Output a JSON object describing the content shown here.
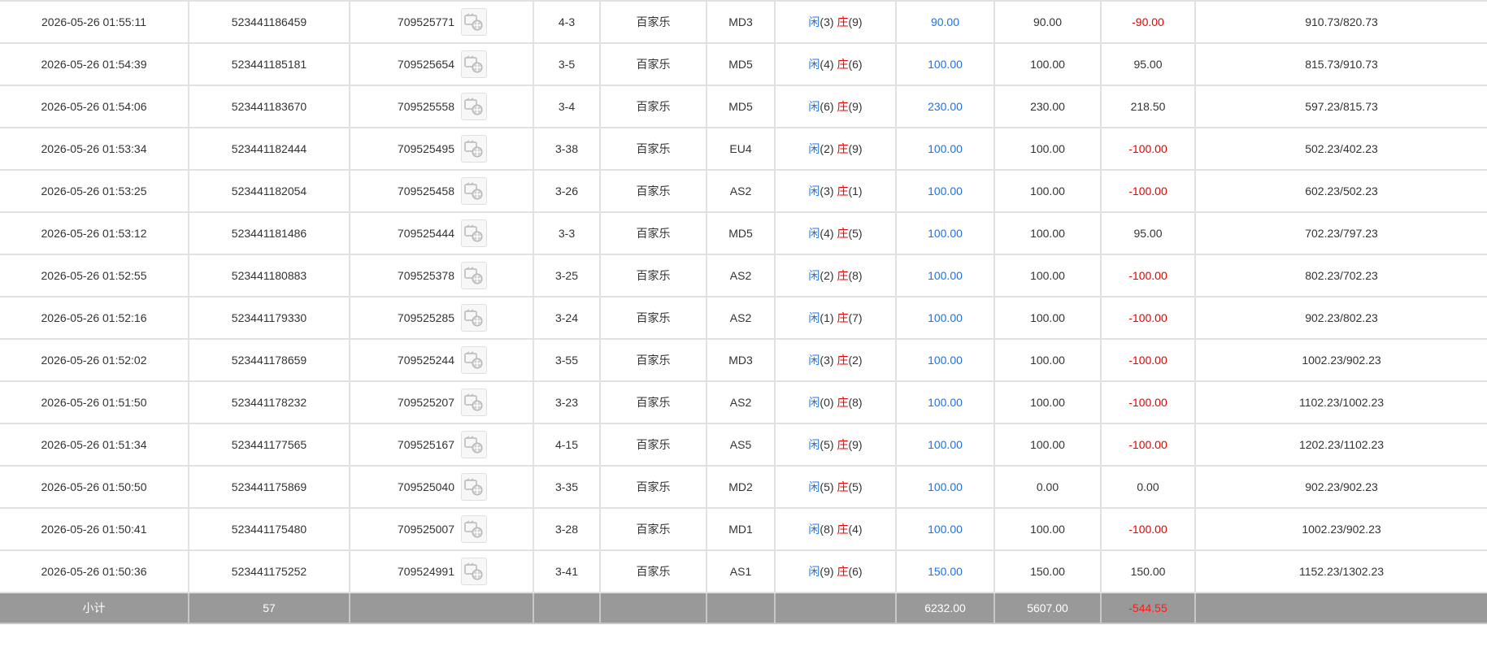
{
  "rows": [
    {
      "time": "2026-05-26 01:55:11",
      "order": "523441186459",
      "game": "709525771",
      "table": "4-3",
      "type": "百家乐",
      "room": "MD3",
      "player": "3",
      "banker": "9",
      "bet": "90.00",
      "valid": "90.00",
      "win": "-90.00",
      "balance": "910.73/820.73",
      "win_negative": true
    },
    {
      "time": "2026-05-26 01:54:39",
      "order": "523441185181",
      "game": "709525654",
      "table": "3-5",
      "type": "百家乐",
      "room": "MD5",
      "player": "4",
      "banker": "6",
      "bet": "100.00",
      "valid": "100.00",
      "win": "95.00",
      "balance": "815.73/910.73",
      "win_negative": false
    },
    {
      "time": "2026-05-26 01:54:06",
      "order": "523441183670",
      "game": "709525558",
      "table": "3-4",
      "type": "百家乐",
      "room": "MD5",
      "player": "6",
      "banker": "9",
      "bet": "230.00",
      "valid": "230.00",
      "win": "218.50",
      "balance": "597.23/815.73",
      "win_negative": false
    },
    {
      "time": "2026-05-26 01:53:34",
      "order": "523441182444",
      "game": "709525495",
      "table": "3-38",
      "type": "百家乐",
      "room": "EU4",
      "player": "2",
      "banker": "9",
      "bet": "100.00",
      "valid": "100.00",
      "win": "-100.00",
      "balance": "502.23/402.23",
      "win_negative": true
    },
    {
      "time": "2026-05-26 01:53:25",
      "order": "523441182054",
      "game": "709525458",
      "table": "3-26",
      "type": "百家乐",
      "room": "AS2",
      "player": "3",
      "banker": "1",
      "bet": "100.00",
      "valid": "100.00",
      "win": "-100.00",
      "balance": "602.23/502.23",
      "win_negative": true
    },
    {
      "time": "2026-05-26 01:53:12",
      "order": "523441181486",
      "game": "709525444",
      "table": "3-3",
      "type": "百家乐",
      "room": "MD5",
      "player": "4",
      "banker": "5",
      "bet": "100.00",
      "valid": "100.00",
      "win": "95.00",
      "balance": "702.23/797.23",
      "win_negative": false
    },
    {
      "time": "2026-05-26 01:52:55",
      "order": "523441180883",
      "game": "709525378",
      "table": "3-25",
      "type": "百家乐",
      "room": "AS2",
      "player": "2",
      "banker": "8",
      "bet": "100.00",
      "valid": "100.00",
      "win": "-100.00",
      "balance": "802.23/702.23",
      "win_negative": true
    },
    {
      "time": "2026-05-26 01:52:16",
      "order": "523441179330",
      "game": "709525285",
      "table": "3-24",
      "type": "百家乐",
      "room": "AS2",
      "player": "1",
      "banker": "7",
      "bet": "100.00",
      "valid": "100.00",
      "win": "-100.00",
      "balance": "902.23/802.23",
      "win_negative": true
    },
    {
      "time": "2026-05-26 01:52:02",
      "order": "523441178659",
      "game": "709525244",
      "table": "3-55",
      "type": "百家乐",
      "room": "MD3",
      "player": "3",
      "banker": "2",
      "bet": "100.00",
      "valid": "100.00",
      "win": "-100.00",
      "balance": "1002.23/902.23",
      "win_negative": true
    },
    {
      "time": "2026-05-26 01:51:50",
      "order": "523441178232",
      "game": "709525207",
      "table": "3-23",
      "type": "百家乐",
      "room": "AS2",
      "player": "0",
      "banker": "8",
      "bet": "100.00",
      "valid": "100.00",
      "win": "-100.00",
      "balance": "1102.23/1002.23",
      "win_negative": true
    },
    {
      "time": "2026-05-26 01:51:34",
      "order": "523441177565",
      "game": "709525167",
      "table": "4-15",
      "type": "百家乐",
      "room": "AS5",
      "player": "5",
      "banker": "9",
      "bet": "100.00",
      "valid": "100.00",
      "win": "-100.00",
      "balance": "1202.23/1102.23",
      "win_negative": true
    },
    {
      "time": "2026-05-26 01:50:50",
      "order": "523441175869",
      "game": "709525040",
      "table": "3-35",
      "type": "百家乐",
      "room": "MD2",
      "player": "5",
      "banker": "5",
      "bet": "100.00",
      "valid": "0.00",
      "win": "0.00",
      "balance": "902.23/902.23",
      "win_negative": false
    },
    {
      "time": "2026-05-26 01:50:41",
      "order": "523441175480",
      "game": "709525007",
      "table": "3-28",
      "type": "百家乐",
      "room": "MD1",
      "player": "8",
      "banker": "4",
      "bet": "100.00",
      "valid": "100.00",
      "win": "-100.00",
      "balance": "1002.23/902.23",
      "win_negative": true
    },
    {
      "time": "2026-05-26 01:50:36",
      "order": "523441175252",
      "game": "709524991",
      "table": "3-41",
      "type": "百家乐",
      "room": "AS1",
      "player": "9",
      "banker": "6",
      "bet": "150.00",
      "valid": "150.00",
      "win": "150.00",
      "balance": "1152.23/1302.23",
      "win_negative": false
    }
  ],
  "labels": {
    "player_label": "闲",
    "banker_label": "庄"
  },
  "subtotal": {
    "label": "小计",
    "count": "57",
    "bet": "6232.00",
    "valid": "5607.00",
    "win": "-544.55"
  },
  "colors": {
    "player": "#1a73e8",
    "banker": "#e60000",
    "negative": "#e60000",
    "subtotal_bg": "#999999"
  },
  "icons": {
    "replay": "video-replay-icon"
  }
}
